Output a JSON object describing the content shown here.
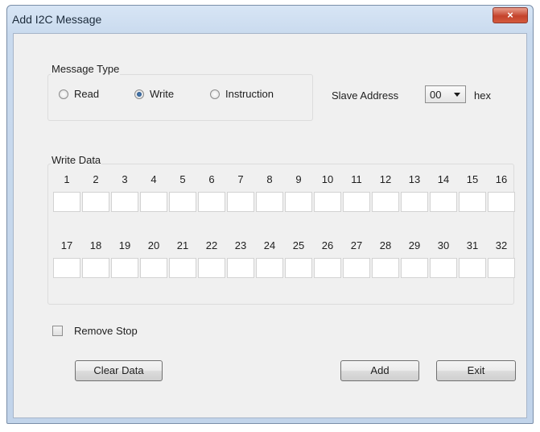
{
  "window": {
    "title": "Add I2C Message",
    "close_label": "×"
  },
  "message_type": {
    "label": "Message Type",
    "options": [
      {
        "label": "Read",
        "selected": false
      },
      {
        "label": "Write",
        "selected": true
      },
      {
        "label": "Instruction",
        "selected": false
      }
    ]
  },
  "slave_address": {
    "label": "Slave Address",
    "value": "00",
    "unit": "hex"
  },
  "write_data": {
    "label": "Write Data",
    "row1_numbers": [
      "1",
      "2",
      "3",
      "4",
      "5",
      "6",
      "7",
      "8",
      "9",
      "10",
      "11",
      "12",
      "13",
      "14",
      "15",
      "16"
    ],
    "row2_numbers": [
      "17",
      "18",
      "19",
      "20",
      "21",
      "22",
      "23",
      "24",
      "25",
      "26",
      "27",
      "28",
      "29",
      "30",
      "31",
      "32"
    ]
  },
  "remove_stop": {
    "label": "Remove Stop",
    "checked": false
  },
  "buttons": {
    "clear_data": "Clear Data",
    "add": "Add",
    "exit": "Exit"
  },
  "colors": {
    "title_bar": "#c9daee",
    "close_button": "#c4432c",
    "client_background": "#f0f0f0",
    "selected_radio": "#1d4a82"
  }
}
